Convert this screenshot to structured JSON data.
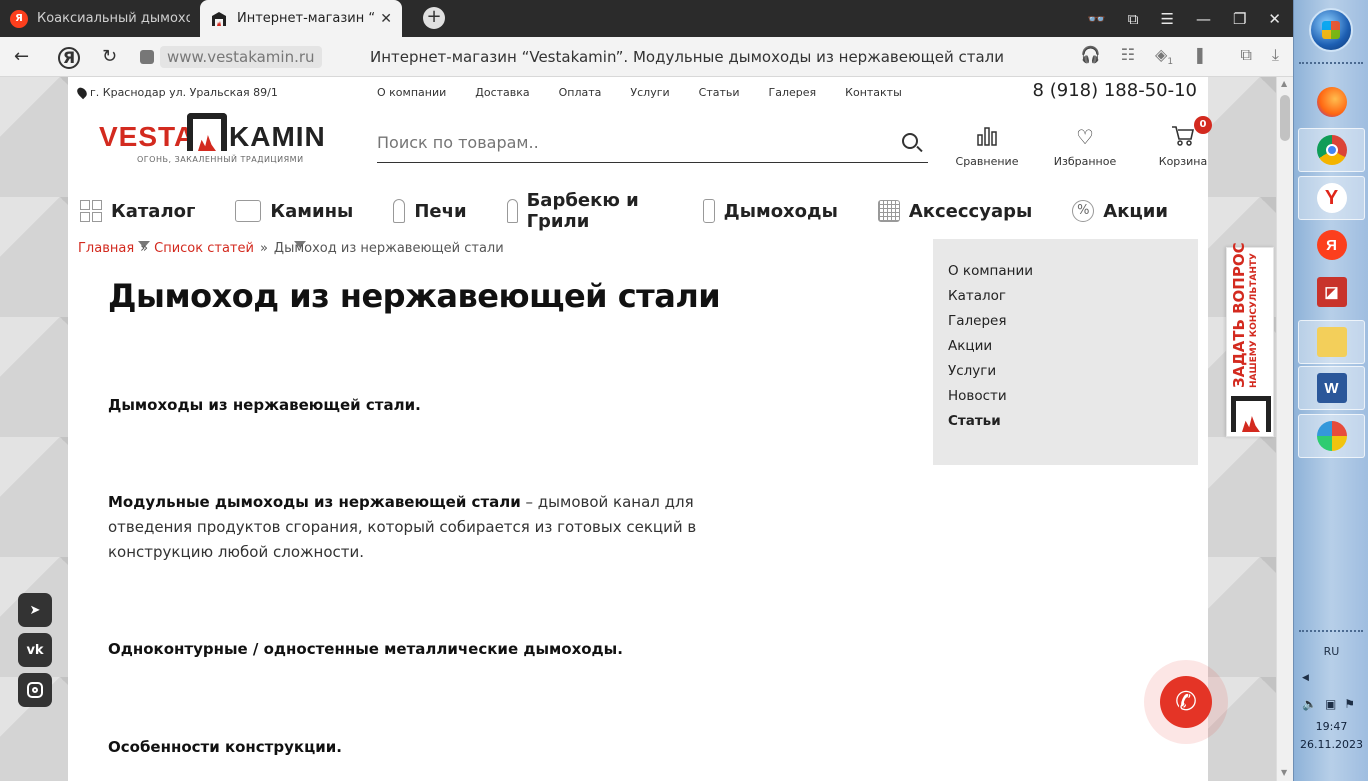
{
  "browser": {
    "tabs": [
      {
        "title": "Коаксиальный дымоход В",
        "favicon": "yandex-icon",
        "active": false
      },
      {
        "title": "Интернет-магазин “Ves",
        "favicon": "fireplace-icon",
        "active": true
      }
    ],
    "new_tab": "+",
    "url": "www.vestakamin.ru",
    "page_title": "Интернет-магазин “Vestakamin”. Модульные дымоходы из нержавеющей стали",
    "yandex_btn": "Я",
    "lens_badge": "1"
  },
  "site": {
    "address": "г. Краснодар ул. Уральская 89/1",
    "topnav": [
      "О компании",
      "Доставка",
      "Оплата",
      "Услуги",
      "Статьи",
      "Галерея",
      "Контакты"
    ],
    "phone": "8 (918) 188-50-10",
    "logo": {
      "word1": "VESTA",
      "word2": "KAMIN",
      "slogan": "ОГОНЬ, ЗАКАЛЕННЫЙ ТРАДИЦИЯМИ"
    },
    "search": {
      "placeholder": "Поиск по товарам.."
    },
    "actions": {
      "compare": "Сравнение",
      "favorites": "Избранное",
      "cart": "Корзина",
      "cart_count": "0"
    },
    "menu": [
      {
        "label": "Каталог",
        "icon": "grid-icon",
        "has_dropdown": true
      },
      {
        "label": "Камины",
        "icon": "fireplace-icon",
        "has_dropdown": true
      },
      {
        "label": "Печи",
        "icon": "stove-icon",
        "has_dropdown": false
      },
      {
        "label": "Барбекю и Грили",
        "icon": "grill-icon",
        "has_dropdown": false
      },
      {
        "label": "Дымоходы",
        "icon": "chimney-icon",
        "has_dropdown": false
      },
      {
        "label": "Аксессуары",
        "icon": "accessories-icon",
        "has_dropdown": false
      },
      {
        "label": "Акции",
        "icon": "percent-icon",
        "has_dropdown": false
      }
    ],
    "breadcrumb": {
      "home": "Главная",
      "list": "Список статей",
      "sep": "»",
      "current": "Дымоход из нержавеющей стали"
    },
    "article": {
      "title": "Дымоход из нержавеющей стали",
      "p1": "Дымоходы из нержавеющей стали.",
      "p2_bold": "Модульные дымоходы из нержавеющей стали",
      "p2_rest": " – дымовой канал для отведения продуктов сгорания, который собирается из готовых секций в конструкцию любой сложности.",
      "p3": "Одноконтурные / одностенные металлические дымоходы.",
      "p4": "Особенности конструкции."
    },
    "sidebar": [
      "О компании",
      "Каталог",
      "Галерея",
      "Акции",
      "Услуги",
      "Новости",
      "Статьи"
    ],
    "sidebar_active": "Статьи",
    "ask_widget": {
      "line1": "ЗАДАТЬ ВОПРОС",
      "line2": "НАШЕМУ КОНСУЛЬТАНТУ"
    },
    "social": [
      "telegram-icon",
      "vk-icon",
      "instagram-icon"
    ]
  },
  "taskbar": {
    "lang": "RU",
    "time": "19:47",
    "date": "26.11.2023"
  },
  "colors": {
    "accent": "#d32a1f",
    "call": "#e43426",
    "taskbar": "#b7cfe8"
  }
}
